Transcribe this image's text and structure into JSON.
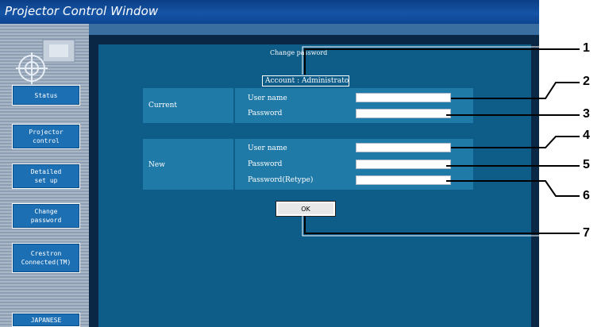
{
  "window": {
    "title": "Projector Control Window"
  },
  "sidebar": {
    "items": [
      {
        "label": "Status"
      },
      {
        "label": "Projector\ncontrol"
      },
      {
        "label": "Detailed\nset up"
      },
      {
        "label": "Change\npassword"
      },
      {
        "label": "Crestron\nConnected(TM)"
      },
      {
        "label": "JAPANESE"
      }
    ]
  },
  "form": {
    "title": "Change password",
    "account_label": "Account : Administrato",
    "current": {
      "label": "Current",
      "user_name_label": "User name",
      "user_name_value": "",
      "password_label": "Password",
      "password_value": ""
    },
    "new": {
      "label": "New",
      "user_name_label": "User name",
      "user_name_value": "",
      "password_label": "Password",
      "password_value": "",
      "retype_label": "Password(Retype)",
      "retype_value": ""
    },
    "ok_label": "OK"
  },
  "callouts": [
    "1",
    "2",
    "3",
    "4",
    "5",
    "6",
    "7"
  ]
}
